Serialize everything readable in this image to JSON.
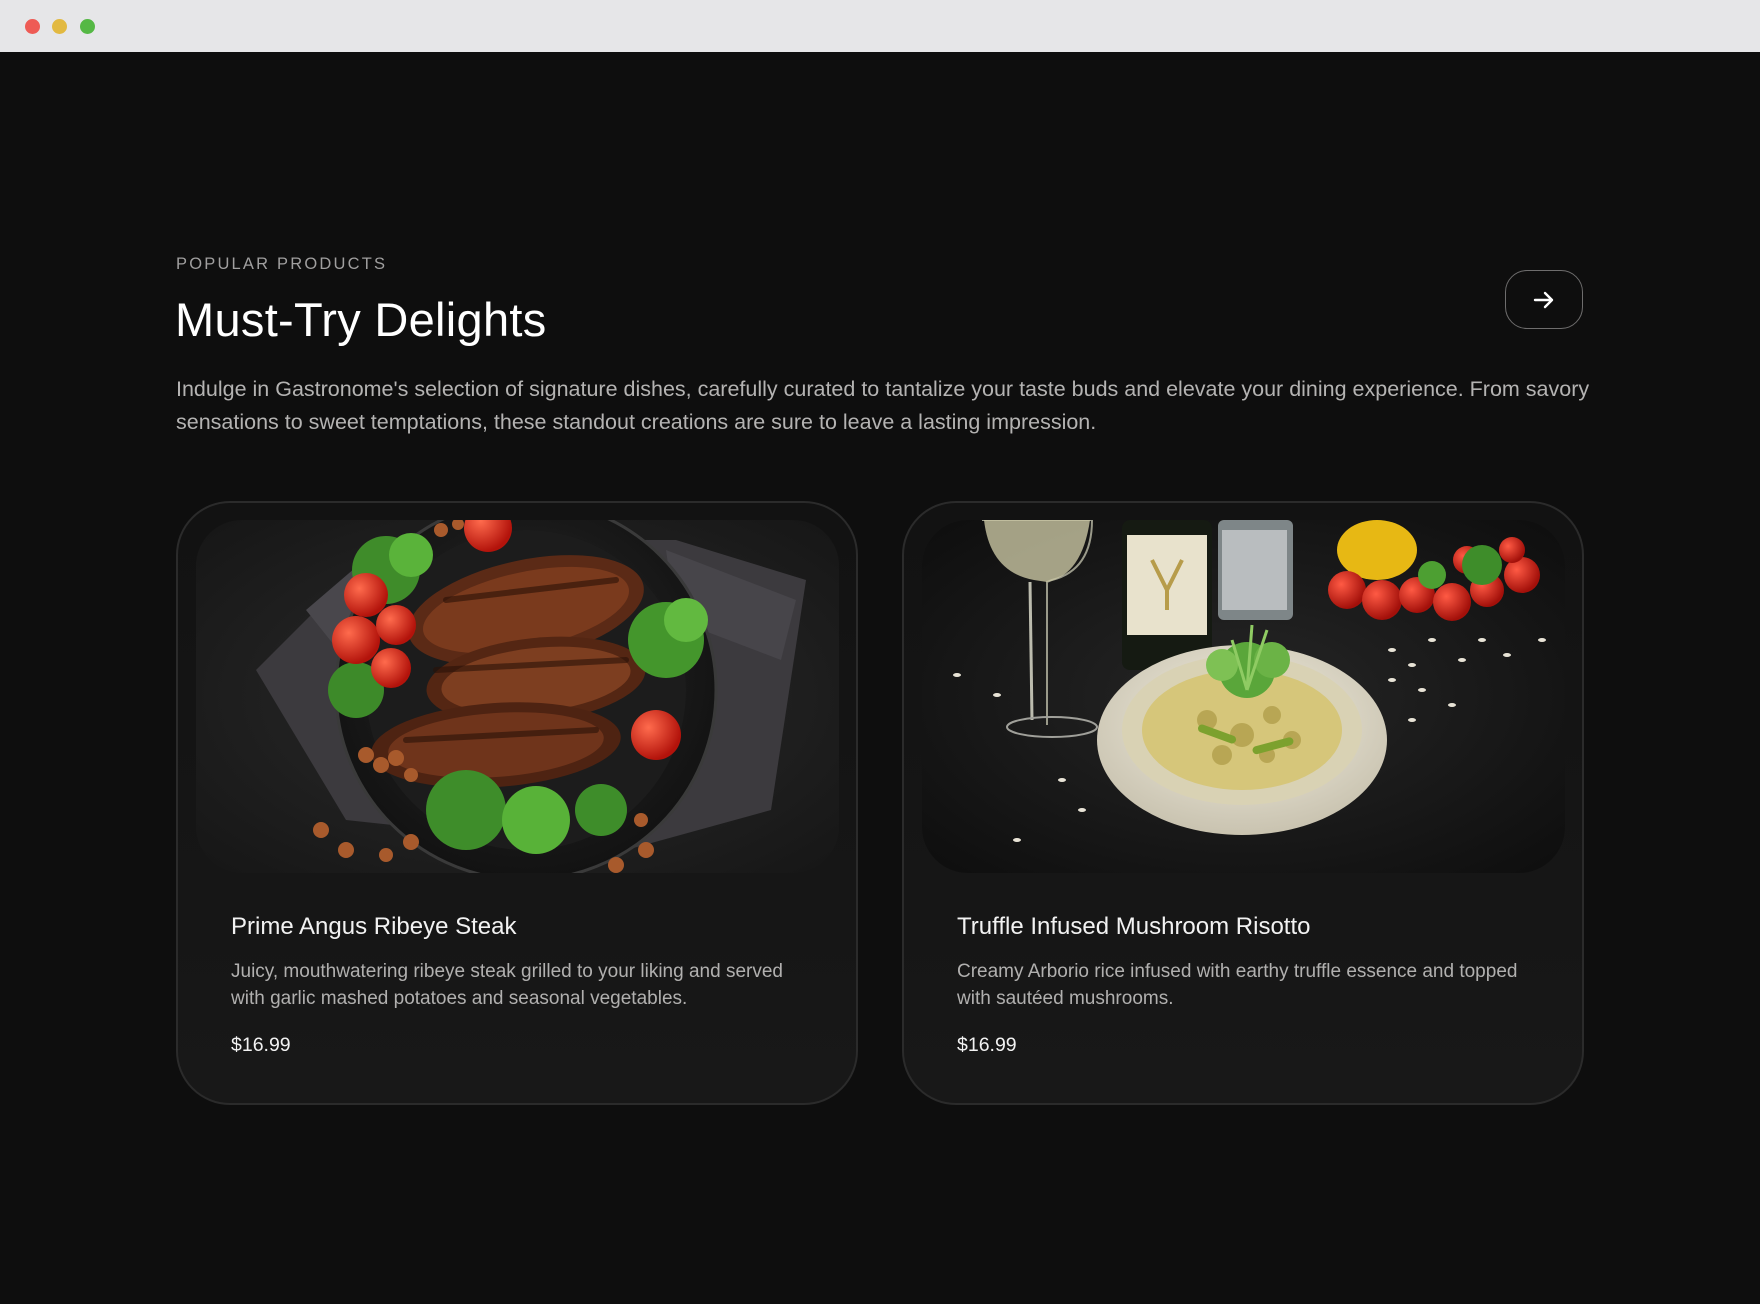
{
  "window": {
    "controls": [
      "close",
      "minimize",
      "maximize"
    ]
  },
  "section": {
    "eyebrow": "POPULAR PRODUCTS",
    "title": "Must-Try Delights",
    "intro": "Indulge in Gastronome's selection of signature dishes, carefully curated to tantalize your taste buds and elevate your dining experience. From savory sensations to sweet temptations, these standout creations are sure to leave a lasting impression.",
    "next_icon": "arrow-right-icon"
  },
  "products": [
    {
      "name": "Prime Angus Ribeye Steak",
      "description": "Juicy, mouthwatering ribeye steak grilled to your liking and served with garlic mashed potatoes and seasonal vegetables.",
      "price": "$16.99",
      "image_subject": "grilled steak with tomatoes and parsley on dark plate"
    },
    {
      "name": "Truffle Infused Mushroom Risotto",
      "description": "Creamy Arborio rice infused with earthy truffle essence and topped with sautéed mushrooms.",
      "price": "$16.99",
      "image_subject": "risotto bowl with wine glass and bottles"
    }
  ],
  "colors": {
    "background": "#0e0e0e",
    "card_border": "#2b2b2b",
    "text_primary": "#ffffff",
    "text_muted": "#b4b3b2"
  }
}
